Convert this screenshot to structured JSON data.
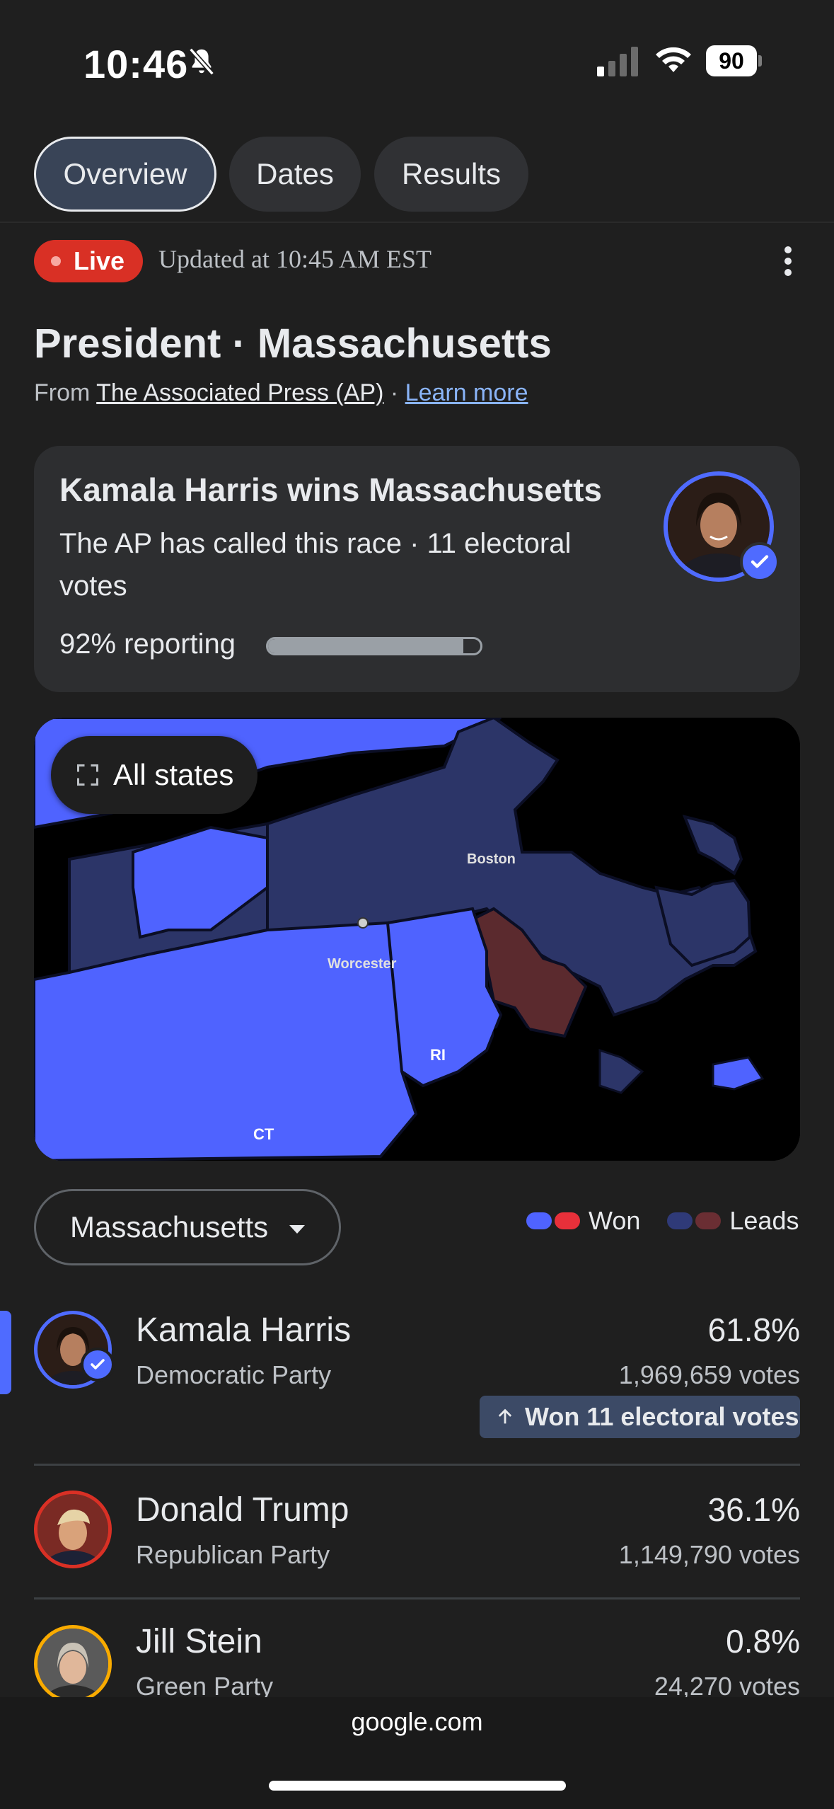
{
  "status_bar": {
    "time": "10:46",
    "battery": "90",
    "icons": [
      "bell-slash-icon",
      "cellular-signal-icon",
      "wifi-icon",
      "battery-icon"
    ]
  },
  "tabs": [
    {
      "label": "Overview",
      "active": true
    },
    {
      "label": "Dates",
      "active": false
    },
    {
      "label": "Results",
      "active": false
    }
  ],
  "live": {
    "label": "Live",
    "updated": "Updated at 10:45 AM EST"
  },
  "race": {
    "title": "President · Massachusetts",
    "source_prefix": "From ",
    "source_name": "The Associated Press (AP)",
    "source_sep": " · ",
    "learn_more": "Learn more"
  },
  "winner_card": {
    "title": "Kamala Harris wins Massachusetts",
    "description": "The AP has called this race · 11 electoral votes",
    "reporting_text": "92% reporting",
    "reporting_fraction": 0.92
  },
  "map": {
    "all_states_label": "All states",
    "labels": {
      "boston": "Boston",
      "worcester": "Worcester",
      "ri": "RI",
      "ct": "CT"
    },
    "colors": {
      "dem_won": "#4f63ff",
      "dem_leads": "#2c3568",
      "rep_leads": "#5b2a2e",
      "water": "#000000"
    }
  },
  "selector": {
    "state": "Massachusetts"
  },
  "legend": {
    "won_label": "Won",
    "leads_label": "Leads",
    "colors": {
      "dem_won": "#4f63ff",
      "rep_won": "#e8303a",
      "dem_leads": "#2f3a78",
      "rep_leads": "#6a2e33"
    }
  },
  "candidates": [
    {
      "name": "Kamala Harris",
      "party": "Democratic Party",
      "percent": "61.8%",
      "votes": "1,969,659 votes",
      "won_badge": "Won 11 electoral votes",
      "ring_color": "#4f6bff"
    },
    {
      "name": "Donald Trump",
      "party": "Republican Party",
      "percent": "36.1%",
      "votes": "1,149,790 votes",
      "ring_color": "#d93025"
    },
    {
      "name": "Jill Stein",
      "party": "Green Party",
      "percent": "0.8%",
      "votes": "24,270 votes",
      "ring_color": "#f9ab00"
    }
  ],
  "browser": {
    "url": "google.com"
  }
}
